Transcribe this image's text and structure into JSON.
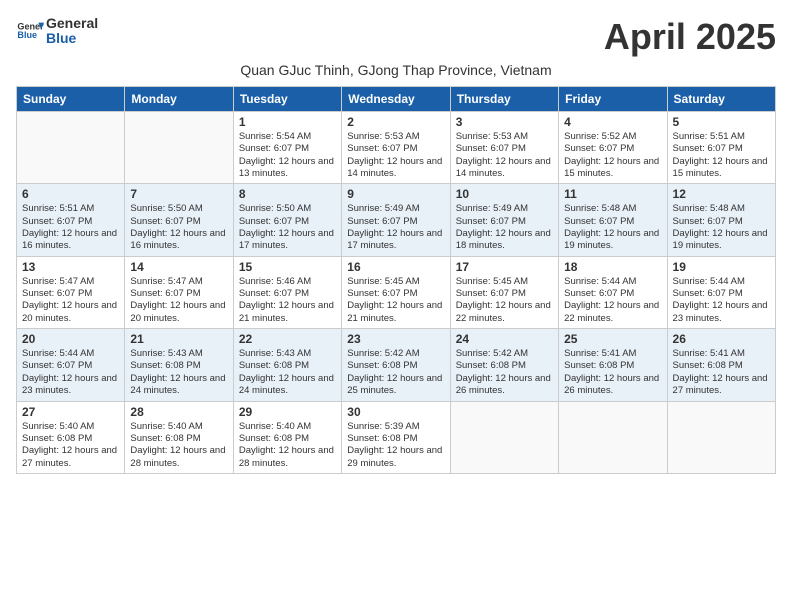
{
  "header": {
    "logo_line1": "General",
    "logo_line2": "Blue",
    "month_title": "April 2025",
    "subtitle": "Quan GJuc Thinh, GJong Thap Province, Vietnam"
  },
  "weekdays": [
    "Sunday",
    "Monday",
    "Tuesday",
    "Wednesday",
    "Thursday",
    "Friday",
    "Saturday"
  ],
  "weeks": [
    [
      {
        "day": "",
        "text": ""
      },
      {
        "day": "",
        "text": ""
      },
      {
        "day": "1",
        "text": "Sunrise: 5:54 AM\nSunset: 6:07 PM\nDaylight: 12 hours and 13 minutes."
      },
      {
        "day": "2",
        "text": "Sunrise: 5:53 AM\nSunset: 6:07 PM\nDaylight: 12 hours and 14 minutes."
      },
      {
        "day": "3",
        "text": "Sunrise: 5:53 AM\nSunset: 6:07 PM\nDaylight: 12 hours and 14 minutes."
      },
      {
        "day": "4",
        "text": "Sunrise: 5:52 AM\nSunset: 6:07 PM\nDaylight: 12 hours and 15 minutes."
      },
      {
        "day": "5",
        "text": "Sunrise: 5:51 AM\nSunset: 6:07 PM\nDaylight: 12 hours and 15 minutes."
      }
    ],
    [
      {
        "day": "6",
        "text": "Sunrise: 5:51 AM\nSunset: 6:07 PM\nDaylight: 12 hours and 16 minutes."
      },
      {
        "day": "7",
        "text": "Sunrise: 5:50 AM\nSunset: 6:07 PM\nDaylight: 12 hours and 16 minutes."
      },
      {
        "day": "8",
        "text": "Sunrise: 5:50 AM\nSunset: 6:07 PM\nDaylight: 12 hours and 17 minutes."
      },
      {
        "day": "9",
        "text": "Sunrise: 5:49 AM\nSunset: 6:07 PM\nDaylight: 12 hours and 17 minutes."
      },
      {
        "day": "10",
        "text": "Sunrise: 5:49 AM\nSunset: 6:07 PM\nDaylight: 12 hours and 18 minutes."
      },
      {
        "day": "11",
        "text": "Sunrise: 5:48 AM\nSunset: 6:07 PM\nDaylight: 12 hours and 19 minutes."
      },
      {
        "day": "12",
        "text": "Sunrise: 5:48 AM\nSunset: 6:07 PM\nDaylight: 12 hours and 19 minutes."
      }
    ],
    [
      {
        "day": "13",
        "text": "Sunrise: 5:47 AM\nSunset: 6:07 PM\nDaylight: 12 hours and 20 minutes."
      },
      {
        "day": "14",
        "text": "Sunrise: 5:47 AM\nSunset: 6:07 PM\nDaylight: 12 hours and 20 minutes."
      },
      {
        "day": "15",
        "text": "Sunrise: 5:46 AM\nSunset: 6:07 PM\nDaylight: 12 hours and 21 minutes."
      },
      {
        "day": "16",
        "text": "Sunrise: 5:45 AM\nSunset: 6:07 PM\nDaylight: 12 hours and 21 minutes."
      },
      {
        "day": "17",
        "text": "Sunrise: 5:45 AM\nSunset: 6:07 PM\nDaylight: 12 hours and 22 minutes."
      },
      {
        "day": "18",
        "text": "Sunrise: 5:44 AM\nSunset: 6:07 PM\nDaylight: 12 hours and 22 minutes."
      },
      {
        "day": "19",
        "text": "Sunrise: 5:44 AM\nSunset: 6:07 PM\nDaylight: 12 hours and 23 minutes."
      }
    ],
    [
      {
        "day": "20",
        "text": "Sunrise: 5:44 AM\nSunset: 6:07 PM\nDaylight: 12 hours and 23 minutes."
      },
      {
        "day": "21",
        "text": "Sunrise: 5:43 AM\nSunset: 6:08 PM\nDaylight: 12 hours and 24 minutes."
      },
      {
        "day": "22",
        "text": "Sunrise: 5:43 AM\nSunset: 6:08 PM\nDaylight: 12 hours and 24 minutes."
      },
      {
        "day": "23",
        "text": "Sunrise: 5:42 AM\nSunset: 6:08 PM\nDaylight: 12 hours and 25 minutes."
      },
      {
        "day": "24",
        "text": "Sunrise: 5:42 AM\nSunset: 6:08 PM\nDaylight: 12 hours and 26 minutes."
      },
      {
        "day": "25",
        "text": "Sunrise: 5:41 AM\nSunset: 6:08 PM\nDaylight: 12 hours and 26 minutes."
      },
      {
        "day": "26",
        "text": "Sunrise: 5:41 AM\nSunset: 6:08 PM\nDaylight: 12 hours and 27 minutes."
      }
    ],
    [
      {
        "day": "27",
        "text": "Sunrise: 5:40 AM\nSunset: 6:08 PM\nDaylight: 12 hours and 27 minutes."
      },
      {
        "day": "28",
        "text": "Sunrise: 5:40 AM\nSunset: 6:08 PM\nDaylight: 12 hours and 28 minutes."
      },
      {
        "day": "29",
        "text": "Sunrise: 5:40 AM\nSunset: 6:08 PM\nDaylight: 12 hours and 28 minutes."
      },
      {
        "day": "30",
        "text": "Sunrise: 5:39 AM\nSunset: 6:08 PM\nDaylight: 12 hours and 29 minutes."
      },
      {
        "day": "",
        "text": ""
      },
      {
        "day": "",
        "text": ""
      },
      {
        "day": "",
        "text": ""
      }
    ]
  ]
}
